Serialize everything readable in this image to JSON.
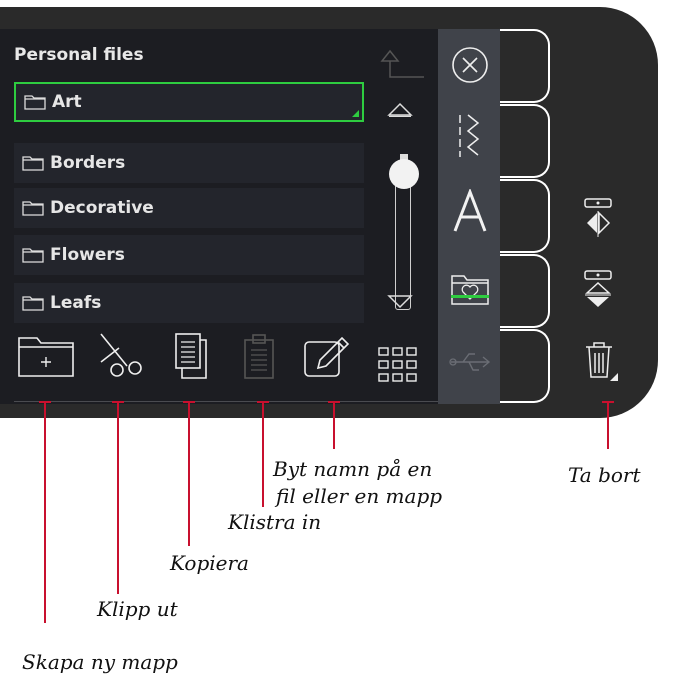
{
  "panel": {
    "title": "Personal files"
  },
  "folders": [
    {
      "label": "Art",
      "selected": true
    },
    {
      "label": "Borders",
      "selected": false
    },
    {
      "label": "Decorative",
      "selected": false
    },
    {
      "label": "Flowers",
      "selected": false
    },
    {
      "label": "Leafs",
      "selected": false
    }
  ],
  "toolbar": [
    "new-folder-icon",
    "cut-icon",
    "copy-icon",
    "paste-icon",
    "rename-icon",
    "grid-view-icon"
  ],
  "sidebar": [
    "close-icon",
    "stitch-icon",
    "font-icon",
    "personal-files-icon",
    "usb-icon"
  ],
  "right_tools": [
    "mirror-side-icon",
    "mirror-end-icon",
    "trash-icon"
  ],
  "callouts": {
    "new_folder": "Skapa ny mapp",
    "cut": "Klipp ut",
    "copy": "Kopiera",
    "paste": "Klistra in",
    "rename_line1": "Byt namn på en",
    "rename_line2": "fil eller en mapp",
    "delete": "Ta bort"
  },
  "colors": {
    "accent": "#2ecc40",
    "callout": "#c8102e",
    "device": "#2a2a2a"
  }
}
